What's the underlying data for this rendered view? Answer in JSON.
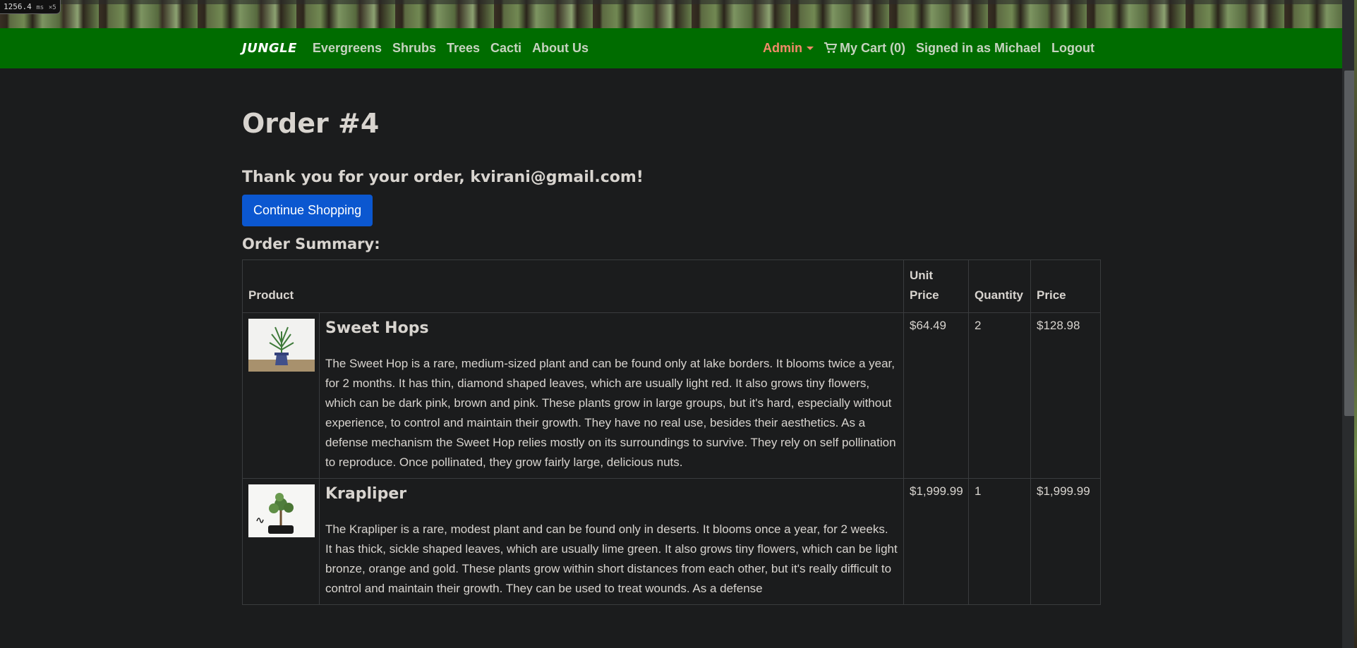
{
  "perf": {
    "value": "1256.4",
    "unit": "ms",
    "multiplier": "×5"
  },
  "navbar": {
    "brand": "JUNGLE",
    "links": [
      "Evergreens",
      "Shrubs",
      "Trees",
      "Cacti",
      "About Us"
    ],
    "admin": "Admin",
    "cart": "My Cart (0)",
    "signed_in": "Signed in as Michael",
    "logout": "Logout"
  },
  "order": {
    "title": "Order #4",
    "thanks": "Thank you for your order, kvirani@gmail.com!",
    "continue_label": "Continue Shopping",
    "summary_title": "Order Summary:"
  },
  "table": {
    "headers": {
      "product": "Product",
      "unit_price": "Unit Price",
      "quantity": "Quantity",
      "price": "Price"
    },
    "rows": [
      {
        "name": "Sweet Hops",
        "description": "The Sweet Hop is a rare, medium-sized plant and can be found only at lake borders. It blooms twice a year, for 2 months. It has thin, diamond shaped leaves, which are usually light red. It also grows tiny flowers, which can be dark pink, brown and pink. These plants grow in large groups, but it's hard, especially without experience, to control and maintain their growth. They have no real use, besides their aesthetics. As a defense mechanism the Sweet Hop relies mostly on its surroundings to survive. They rely on self pollination to reproduce. Once pollinated, they grow fairly large, delicious nuts.",
        "unit_price": "$64.49",
        "quantity": "2",
        "price": "$128.98"
      },
      {
        "name": "Krapliper",
        "description": "The Krapliper is a rare, modest plant and can be found only in deserts. It blooms once a year, for 2 weeks. It has thick, sickle shaped leaves, which are usually lime green. It also grows tiny flowers, which can be light bronze, orange and gold. These plants grow within short distances from each other, but it's really difficult to control and maintain their growth. They can be used to treat wounds. As a defense",
        "unit_price": "$1,999.99",
        "quantity": "1",
        "price": "$1,999.99"
      }
    ]
  },
  "colors": {
    "navbar": "#006c00",
    "button": "#0b57d0",
    "admin": "#f28a6a",
    "background": "#1b1c1d"
  }
}
